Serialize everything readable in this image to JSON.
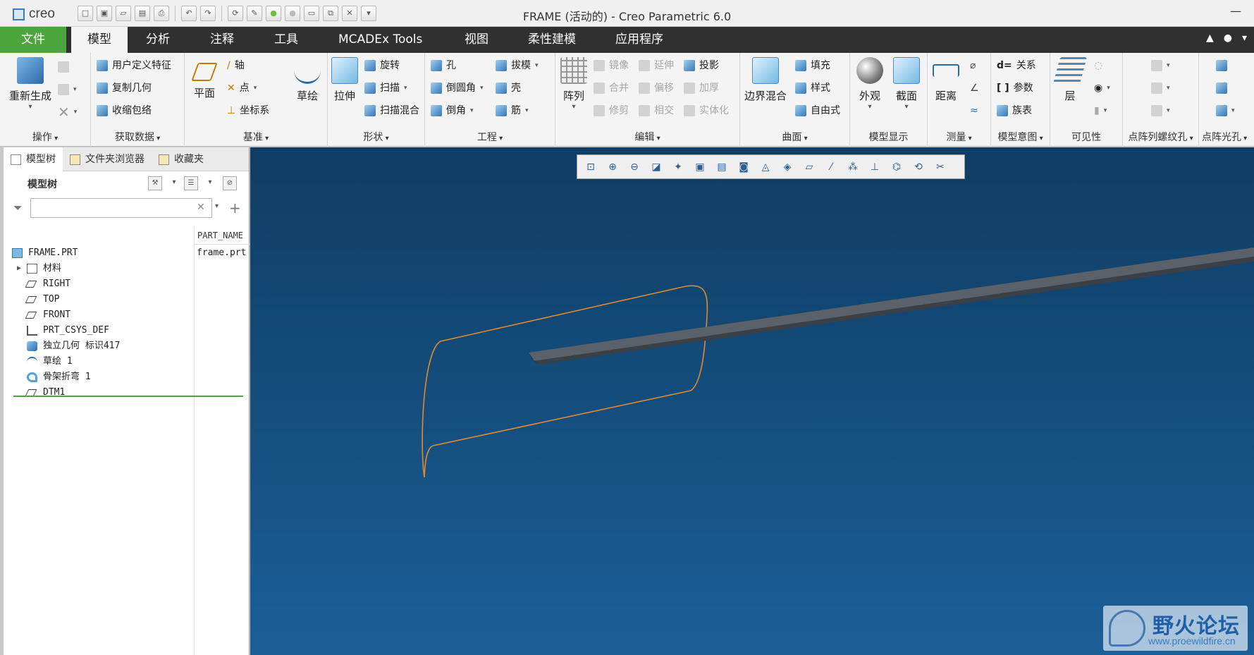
{
  "window": {
    "brand": "creo",
    "title": "FRAME (活动的) - Creo Parametric 6.0",
    "minimize": "—"
  },
  "quick_access": [
    "new-icon",
    "open-window-icon",
    "dropdown-icon",
    "open-icon",
    "save-icon",
    "print-icon",
    "undo-icon",
    "dropdown-icon",
    "redo-icon",
    "dropdown-icon",
    "regenerate-icon",
    "repaint-icon",
    "green-dot-icon",
    "gray-dot-icon",
    "windows-icon",
    "switch-window-icon",
    "dropdown-icon",
    "close-window-icon",
    "customize-icon"
  ],
  "menus": {
    "file": "文件",
    "model": "模型",
    "analysis": "分析",
    "annotate": "注释",
    "tools": "工具",
    "mcadex": "MCADEx Tools",
    "view": "视图",
    "flexible": "柔性建模",
    "apps": "应用程序"
  },
  "ribbon": {
    "operations": {
      "title": "操作",
      "regenerate": "重新生成"
    },
    "get_data": {
      "title": "获取数据",
      "udf": "用户定义特征",
      "copy_geom": "复制几何",
      "shrinkwrap": "收缩包络"
    },
    "datum": {
      "title": "基准",
      "plane": "平面",
      "axis": "轴",
      "point": "点",
      "csys": "坐标系",
      "sketch": "草绘"
    },
    "shapes": {
      "title": "形状",
      "extrude": "拉伸",
      "revolve": "旋转",
      "sweep": "扫描",
      "swept_blend": "扫描混合"
    },
    "engineering": {
      "title": "工程",
      "hole": "孔",
      "round": "倒圆角",
      "chamfer": "倒角",
      "draft": "拔模",
      "shell": "壳",
      "rib": "筋"
    },
    "editing": {
      "title": "编辑",
      "pattern": "阵列",
      "mirror": "镜像",
      "extend": "延伸",
      "project": "投影",
      "merge": "合并",
      "offset": "偏移",
      "thicken": "加厚",
      "trim": "修剪",
      "intersect": "相交",
      "solidify": "实体化"
    },
    "surfaces": {
      "title": "曲面",
      "boundary_blend": "边界混合",
      "fill": "填充",
      "style": "样式",
      "freestyle": "自由式"
    },
    "model_display": {
      "title": "模型显示",
      "appearance": "外观",
      "section": "截面"
    },
    "measure": {
      "title": "测量",
      "distance": "距离"
    },
    "model_intent": {
      "title": "模型意图",
      "relations": "关系",
      "parameters": "参数",
      "family_table": "族表"
    },
    "visibility": {
      "title": "可见性",
      "layers": "层"
    },
    "thread_pattern": {
      "title": "点阵列螺纹孔"
    },
    "light_pattern": {
      "title": "点阵光孔"
    }
  },
  "panel": {
    "tabs": [
      "模型树",
      "文件夹浏览器",
      "收藏夹"
    ],
    "tree_label": "模型树",
    "search_value": "",
    "column_header": "PART_NAME"
  },
  "tree": [
    {
      "label": "FRAME.PRT",
      "value": "frame.prt",
      "icon": "part-icon",
      "level": 0,
      "expandable": false
    },
    {
      "label": "材料",
      "value": "",
      "icon": "material-icon",
      "level": 1,
      "expandable": true
    },
    {
      "label": "RIGHT",
      "value": "",
      "icon": "datum-plane-icon",
      "level": 1,
      "expandable": false
    },
    {
      "label": "TOP",
      "value": "",
      "icon": "datum-plane-icon",
      "level": 1,
      "expandable": false
    },
    {
      "label": "FRONT",
      "value": "",
      "icon": "datum-plane-icon",
      "level": 1,
      "expandable": false
    },
    {
      "label": "PRT_CSYS_DEF",
      "value": "",
      "icon": "csys-icon",
      "level": 1,
      "expandable": false
    },
    {
      "label": "独立几何 标识417",
      "value": "",
      "icon": "independent-geometry-icon",
      "level": 1,
      "expandable": false
    },
    {
      "label": "草绘 1",
      "value": "",
      "icon": "sketch-icon",
      "level": 1,
      "expandable": false
    },
    {
      "label": "骨架折弯 1",
      "value": "",
      "icon": "spinal-bend-icon",
      "level": 1,
      "expandable": false
    },
    {
      "label": "DTM1",
      "value": "",
      "icon": "datum-plane-icon",
      "level": 1,
      "expandable": false
    }
  ],
  "view_toolbar": [
    "refit-icon",
    "zoom-in-icon",
    "zoom-out-icon",
    "repaint-icon",
    "spin-center-icon",
    "saved-orientations-icon",
    "named-views-icon",
    "display-style-icon",
    "perspective-icon",
    "section-icon",
    "plane-display-icon",
    "axis-display-icon",
    "point-display-icon",
    "csys-display-icon",
    "annotation-display-icon",
    "spin-icon",
    "cut-icon"
  ],
  "watermark": {
    "title": "野火论坛",
    "url": "www.proewildfire.cn"
  },
  "colors": {
    "menubar": "#303030",
    "file_tab": "#4ca63d",
    "sketch_outline": "#e08a2e",
    "viewport_top": "#0f3d63",
    "viewport_bottom": "#1b5f98"
  }
}
